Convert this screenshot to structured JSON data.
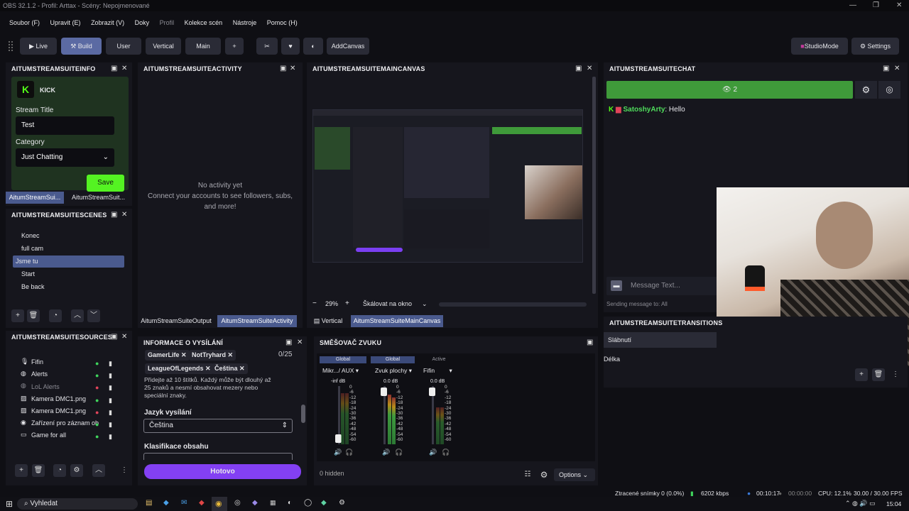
{
  "window_title": "OBS 32.1.2 - Profil: Arttax - Scény: Nepojmenované",
  "menu": [
    "Soubor (F)",
    "Upravit (E)",
    "Zobrazit (V)",
    "Doky",
    "Profil",
    "Kolekce scén",
    "Nástroje",
    "Pomoc (H)"
  ],
  "toolbar": {
    "live": "Live",
    "build": "Build",
    "user": "User",
    "vertical": "Vertical",
    "main": "Main",
    "plus": "+",
    "addcanvas": "AddCanvas",
    "studiomode": "StudioMode",
    "settings": "Settings"
  },
  "info": {
    "title": "AITUMSTREAMSUITEINFO",
    "platform": "KICK",
    "stream_title_label": "Stream Title",
    "stream_title_value": "Test",
    "category_label": "Category",
    "category_value": "Just Chatting",
    "save": "Save",
    "tab1": "AitumStreamSui...",
    "tab2": "AitumStreamSuit..."
  },
  "activity": {
    "title": "AITUMSTREAMSUITEACTIVITY",
    "empty1": "No activity yet",
    "empty2": "Connect your accounts to see followers, subs,",
    "empty3": "and more!",
    "tab1": "AitumStreamSuiteOutput",
    "tab2": "AitumStreamSuiteActivity"
  },
  "canvas": {
    "title": "AITUMSTREAMSUITEMAINCANVAS",
    "zoom": "29%",
    "scale": "Škálovat na okno",
    "tab1": "Vertical",
    "tab2": "AitumStreamSuiteMainCanvas"
  },
  "chat": {
    "title": "AITUMSTREAMSUITECHAT",
    "viewers": "2",
    "user": "SatoshyArty",
    "message": ": Hello",
    "placeholder": "Message Text...",
    "sending": "Sending message to: All"
  },
  "scenes": {
    "title": "AITUMSTREAMSUITESCENES",
    "items": [
      "Konec",
      "full cam",
      "Jsme tu",
      "Start",
      "Be back"
    ]
  },
  "sources": {
    "title": "AITUMSTREAMSUITESOURCES",
    "items": [
      "Fifin",
      "Alerts",
      "LoL Alerts",
      "Kamera DMC1.png",
      "Kamera DMC1.png",
      "Zařízení pro záznam ob",
      "Game for all"
    ]
  },
  "broadcast": {
    "title": "INFORMACE O VYSÍLÁNÍ",
    "tags": [
      "GamerLife",
      "NotTryhard",
      "LeagueOfLegends",
      "Čeština"
    ],
    "count": "0/25",
    "hint": "Přidejte až 10 štítků. Každý může být dlouhý až 25 znaků a nesmí obsahovat mezery nebo speciální znaky.",
    "lang_label": "Jazyk vysílání",
    "lang_value": "Čeština",
    "class_label": "Klasifikace obsahu",
    "done": "Hotovo"
  },
  "mixer": {
    "title": "SMĚŠOVAČ ZVUKU",
    "channels": [
      {
        "badge": "Global",
        "name": "Mikr.../ AUX",
        "db": "-inf dB"
      },
      {
        "badge": "Global",
        "name": "Zvuk plochy",
        "db": "0.0 dB"
      },
      {
        "badge": "Active",
        "name": "Fifin",
        "db": "0.0 dB"
      }
    ],
    "scale": [
      "0",
      "-6",
      "-12",
      "-18",
      "-24",
      "-30",
      "-36",
      "-42",
      "-48",
      "-54",
      "-60"
    ],
    "hidden": "0 hidden",
    "options": "Options"
  },
  "transitions": {
    "title": "AITUMSTREAMSUITETRANSITIONS",
    "item": "Slábnutí",
    "duration": "Délka"
  },
  "status": {
    "dropped": "Ztracené snímky 0 (0.0%)",
    "kbps": "6202 kbps",
    "rec_time": "00:10:17",
    "t2": "00:00:00",
    "cpu": "CPU: 12.1%",
    "fps": "30.00 / 30.00 FPS"
  },
  "taskbar": {
    "search": "Vyhledat",
    "clock": "15:04"
  }
}
